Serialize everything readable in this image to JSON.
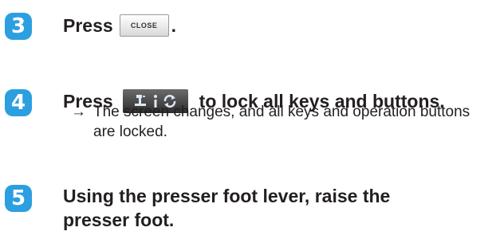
{
  "steps": [
    {
      "number": "3",
      "text_before": "Press",
      "button_label": "CLOSE",
      "text_after": "."
    },
    {
      "number": "4",
      "text_before": "Press",
      "button_icon": "lock-screen-icon",
      "text_after": "to lock all keys and buttons.",
      "result_arrow": "→",
      "result_text": "The screen changes, and all keys and operation buttons are locked."
    },
    {
      "number": "5",
      "line1": "Using the presser foot lever, raise the",
      "line2": "presser foot."
    }
  ],
  "colors": {
    "badge": "#2b9fe0",
    "text": "#231f20"
  }
}
